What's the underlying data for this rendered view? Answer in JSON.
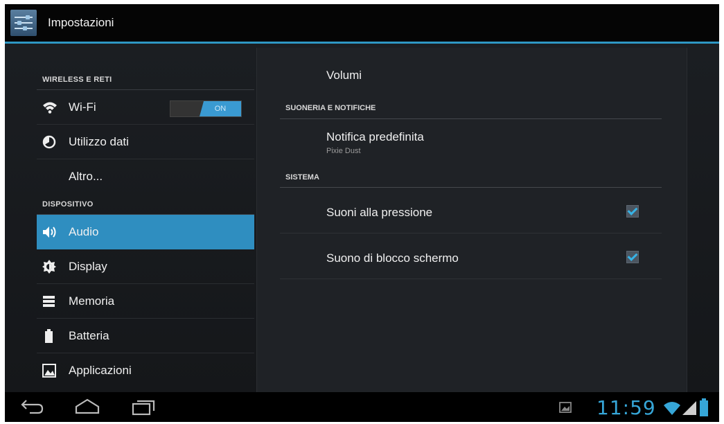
{
  "app": {
    "title": "Impostazioni",
    "icon": "settings-sliders-icon"
  },
  "sidebar": {
    "categories": [
      {
        "label": "WIRELESS E RETI"
      },
      {
        "label": "DISPOSITIVO"
      }
    ],
    "items": [
      {
        "label": "Wi-Fi",
        "icon": "wifi-icon",
        "toggle": "ON"
      },
      {
        "label": "Utilizzo dati",
        "icon": "data-usage-icon"
      },
      {
        "label": "Altro...",
        "icon": ""
      },
      {
        "label": "Audio",
        "icon": "speaker-icon",
        "selected": true
      },
      {
        "label": "Display",
        "icon": "brightness-icon"
      },
      {
        "label": "Memoria",
        "icon": "storage-icon"
      },
      {
        "label": "Batteria",
        "icon": "battery-icon"
      },
      {
        "label": "Applicazioni",
        "icon": "apps-icon"
      }
    ]
  },
  "panel": {
    "volumi": "Volumi",
    "section_ringtone": "SUONERIA E NOTIFICHE",
    "notification": {
      "title": "Notifica predefinita",
      "value": "Pixie Dust"
    },
    "section_system": "SISTEMA",
    "touch_sounds": {
      "label": "Suoni alla pressione",
      "checked": true
    },
    "lock_sound": {
      "label": "Suono di blocco schermo",
      "checked": true
    }
  },
  "navbar": {
    "back_icon": "back-icon",
    "home_icon": "home-icon",
    "recents_icon": "recent-apps-icon",
    "clock": "11:59"
  },
  "colors": {
    "accent": "#2f8ec0",
    "toggle_on": "#3a9ad2",
    "clock": "#36a6d8",
    "background": "#1b1e22"
  }
}
